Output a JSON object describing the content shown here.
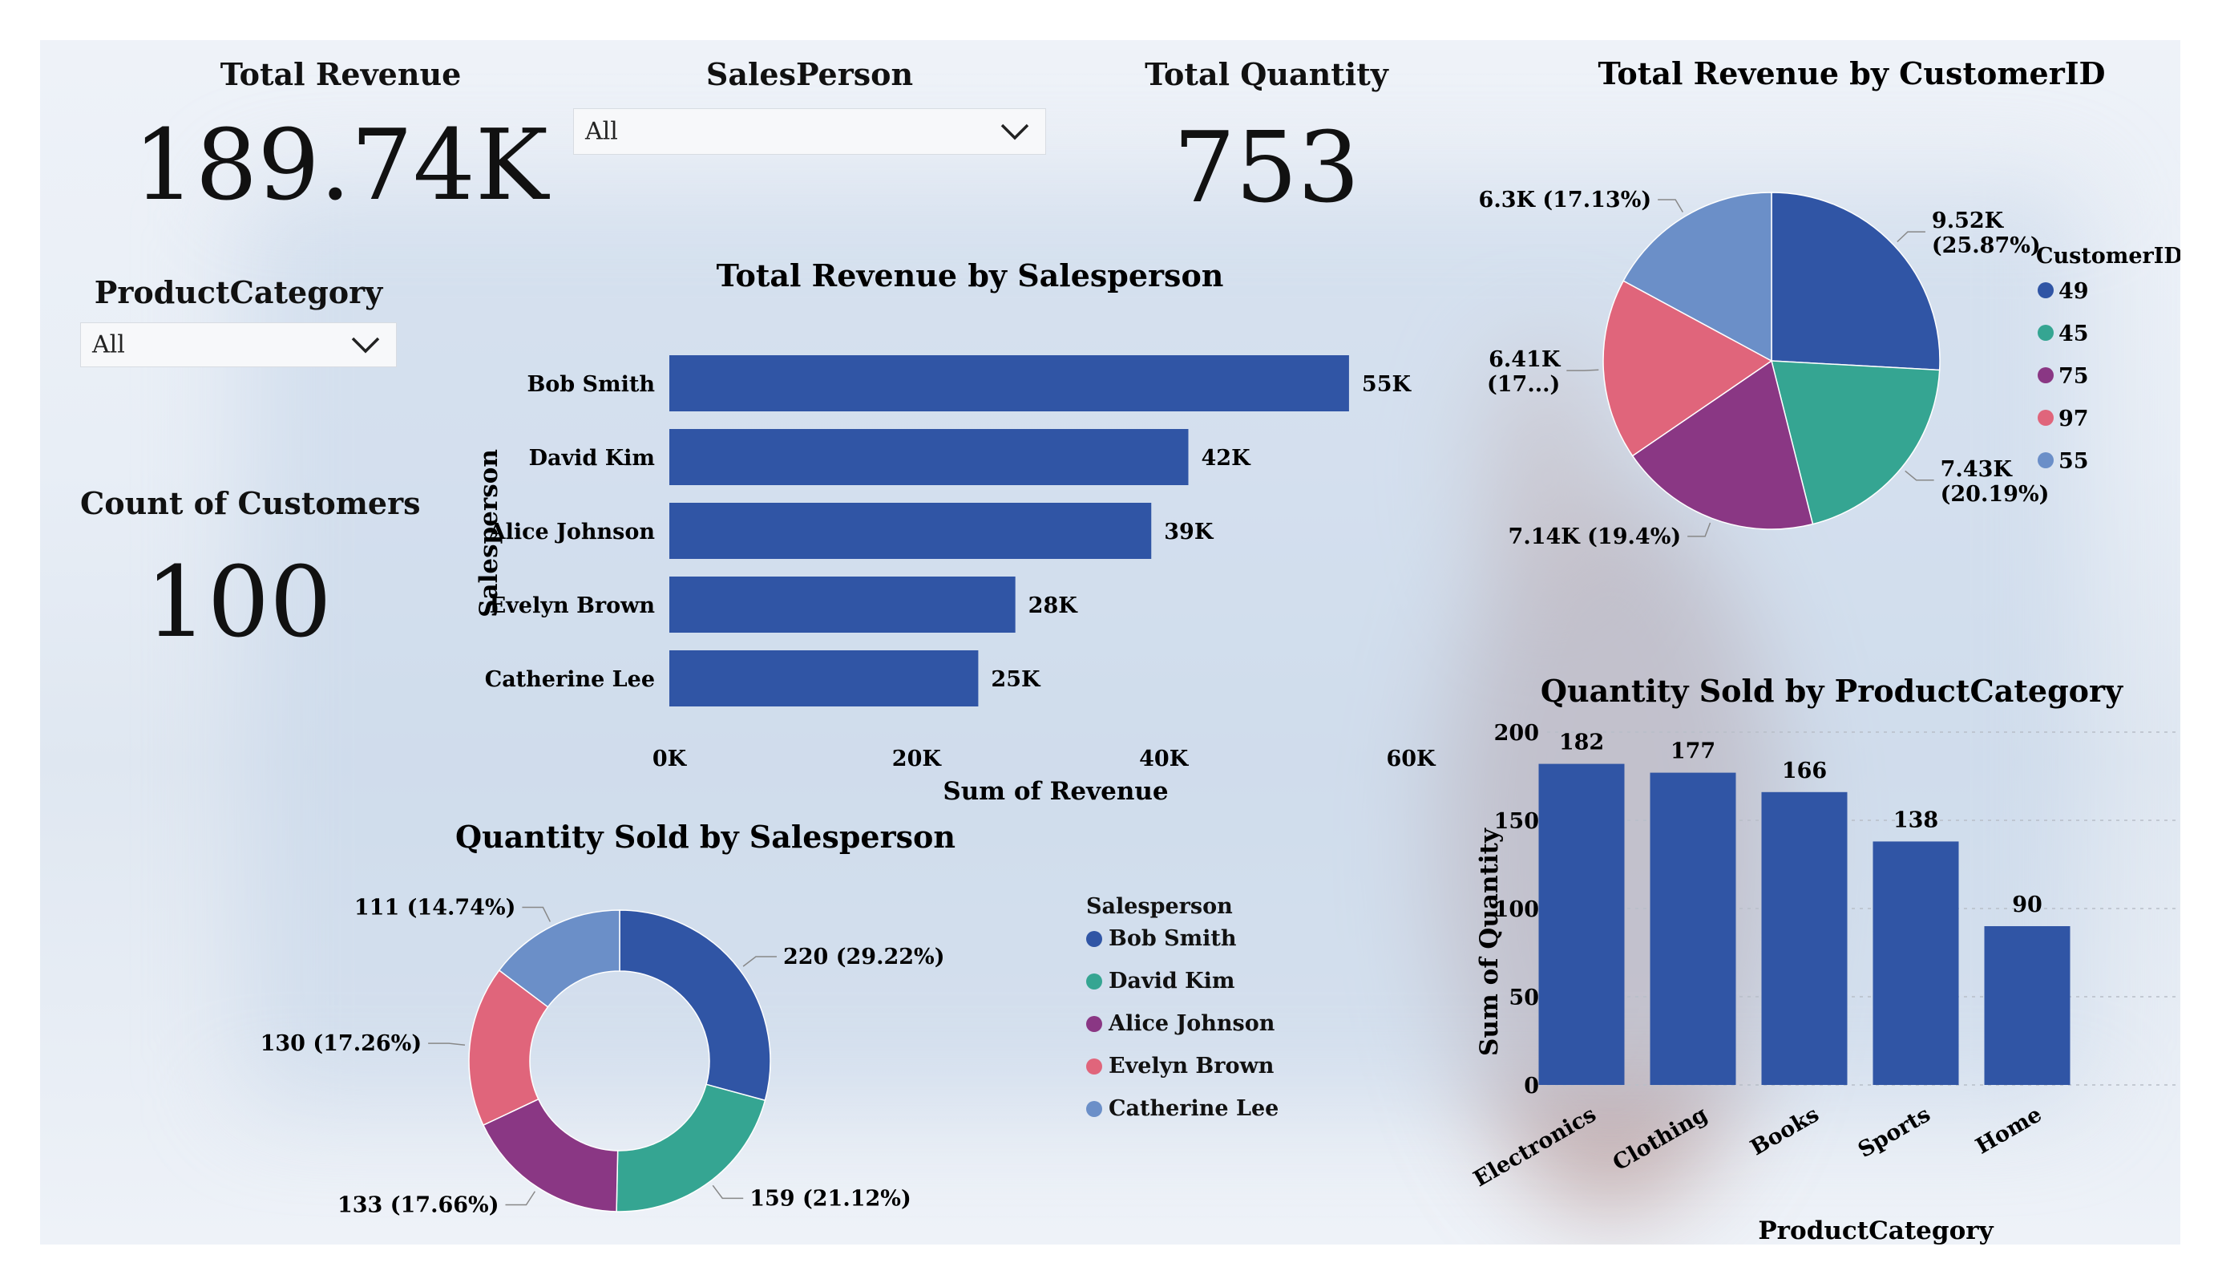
{
  "cards": {
    "total_revenue": {
      "label": "Total Revenue",
      "value": "189.74K"
    },
    "total_quantity": {
      "label": "Total Quantity",
      "value": "753"
    },
    "count_customers": {
      "label": "Count of Customers",
      "value": "100"
    }
  },
  "slicers": {
    "salesperson": {
      "label": "SalesPerson",
      "value": "All"
    },
    "product_category": {
      "label": "ProductCategory",
      "value": "All"
    }
  },
  "colors": {
    "blue": "#3055a5",
    "teal": "#35a592",
    "purple": "#8a3784",
    "pink": "#e0657b",
    "lightblue": "#6b8fc8"
  },
  "chart_data": [
    {
      "id": "revenue_by_salesperson",
      "type": "bar",
      "orientation": "horizontal",
      "title": "Total Revenue by Salesperson",
      "xlabel": "Sum of Revenue",
      "ylabel": "Salesperson",
      "categories": [
        "Bob Smith",
        "David Kim",
        "Alice Johnson",
        "Evelyn Brown",
        "Catherine Lee"
      ],
      "values": [
        55000,
        42000,
        39000,
        28000,
        25000
      ],
      "data_labels": [
        "55K",
        "42K",
        "39K",
        "28K",
        "25K"
      ],
      "xlim": [
        0,
        60000
      ],
      "xticks": [
        "0K",
        "20K",
        "40K",
        "60K"
      ],
      "color": "#3055a5"
    },
    {
      "id": "revenue_by_customer",
      "type": "pie",
      "title": "Total Revenue by CustomerID",
      "legend_title": "CustomerID",
      "legend_position": "right",
      "labels": [
        "49",
        "45",
        "75",
        "97",
        "55"
      ],
      "values": [
        9520,
        7430,
        7140,
        6410,
        6300
      ],
      "data_labels": [
        "9.52K (25.87%)",
        "7.43K (20.19%)",
        "7.14K (19.4%)",
        "6.41K (17...)",
        "6.3K (17.13%)"
      ],
      "colors": [
        "#3055a5",
        "#35a592",
        "#8a3784",
        "#e0657b",
        "#6b8fc8"
      ]
    },
    {
      "id": "quantity_by_salesperson",
      "type": "pie",
      "variant": "donut",
      "title": "Quantity Sold by Salesperson",
      "legend_title": "Salesperson",
      "labels": [
        "Bob Smith",
        "David Kim",
        "Alice Johnson",
        "Evelyn Brown",
        "Catherine Lee"
      ],
      "values": [
        220,
        159,
        133,
        130,
        111
      ],
      "data_labels": [
        "220 (29.22%)",
        "159 (21.12%)",
        "133 (17.66%)",
        "130 (17.26%)",
        "111 (14.74%)"
      ],
      "colors": [
        "#3055a5",
        "#35a592",
        "#8a3784",
        "#e0657b",
        "#6b8fc8"
      ]
    },
    {
      "id": "quantity_by_category",
      "type": "bar",
      "title": "Quantity Sold by ProductCategory",
      "xlabel": "ProductCategory",
      "ylabel": "Sum of Quantity",
      "categories": [
        "Electronics",
        "Clothing",
        "Books",
        "Sports",
        "Home"
      ],
      "values": [
        182,
        177,
        166,
        138,
        90
      ],
      "ylim": [
        0,
        200
      ],
      "yticks": [
        0,
        50,
        100,
        150,
        200
      ],
      "grid": true,
      "color": "#3055a5"
    }
  ]
}
